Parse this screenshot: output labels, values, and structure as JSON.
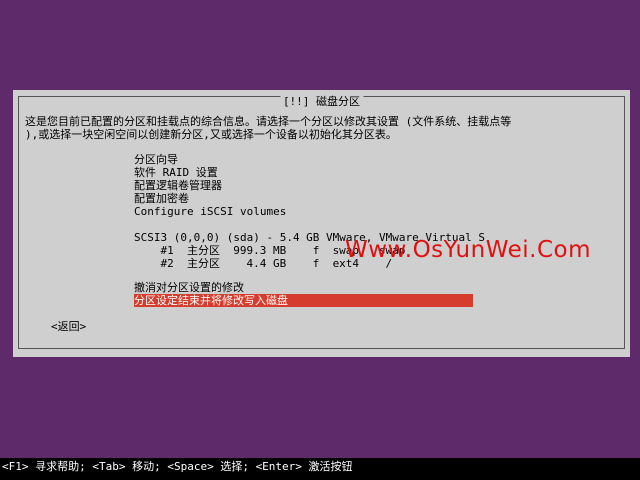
{
  "dialog": {
    "title": "[!!] 磁盘分区",
    "description_line1": "这是您目前已配置的分区和挂载点的综合信息。请选择一个分区以修改其设置 (文件系统、挂载点等",
    "description_line2": "),或选择一块空闲空间以创建新分区,又或选择一个设备以初始化其分区表。",
    "menu_items": [
      "分区向导",
      "软件 RAID 设置",
      "配置逻辑卷管理器",
      "配置加密卷",
      "Configure iSCSI volumes"
    ],
    "disk": "SCSI3 (0,0,0) (sda) - 5.4 GB VMware, VMware Virtual S",
    "partitions": [
      "    #1  主分区  999.3 MB    f  swap   swap",
      "    #2  主分区    4.4 GB    f  ext4    /"
    ],
    "undo_changes": "撤消对分区设置的修改",
    "finish_partitioning": "分区设定结束并将修改写入磁盘",
    "back_button": "<返回>"
  },
  "watermark": "Www.OsYunWei.Com",
  "footer": "<F1> 寻求帮助; <Tab> 移动; <Space> 选择; <Enter> 激活按钮"
}
